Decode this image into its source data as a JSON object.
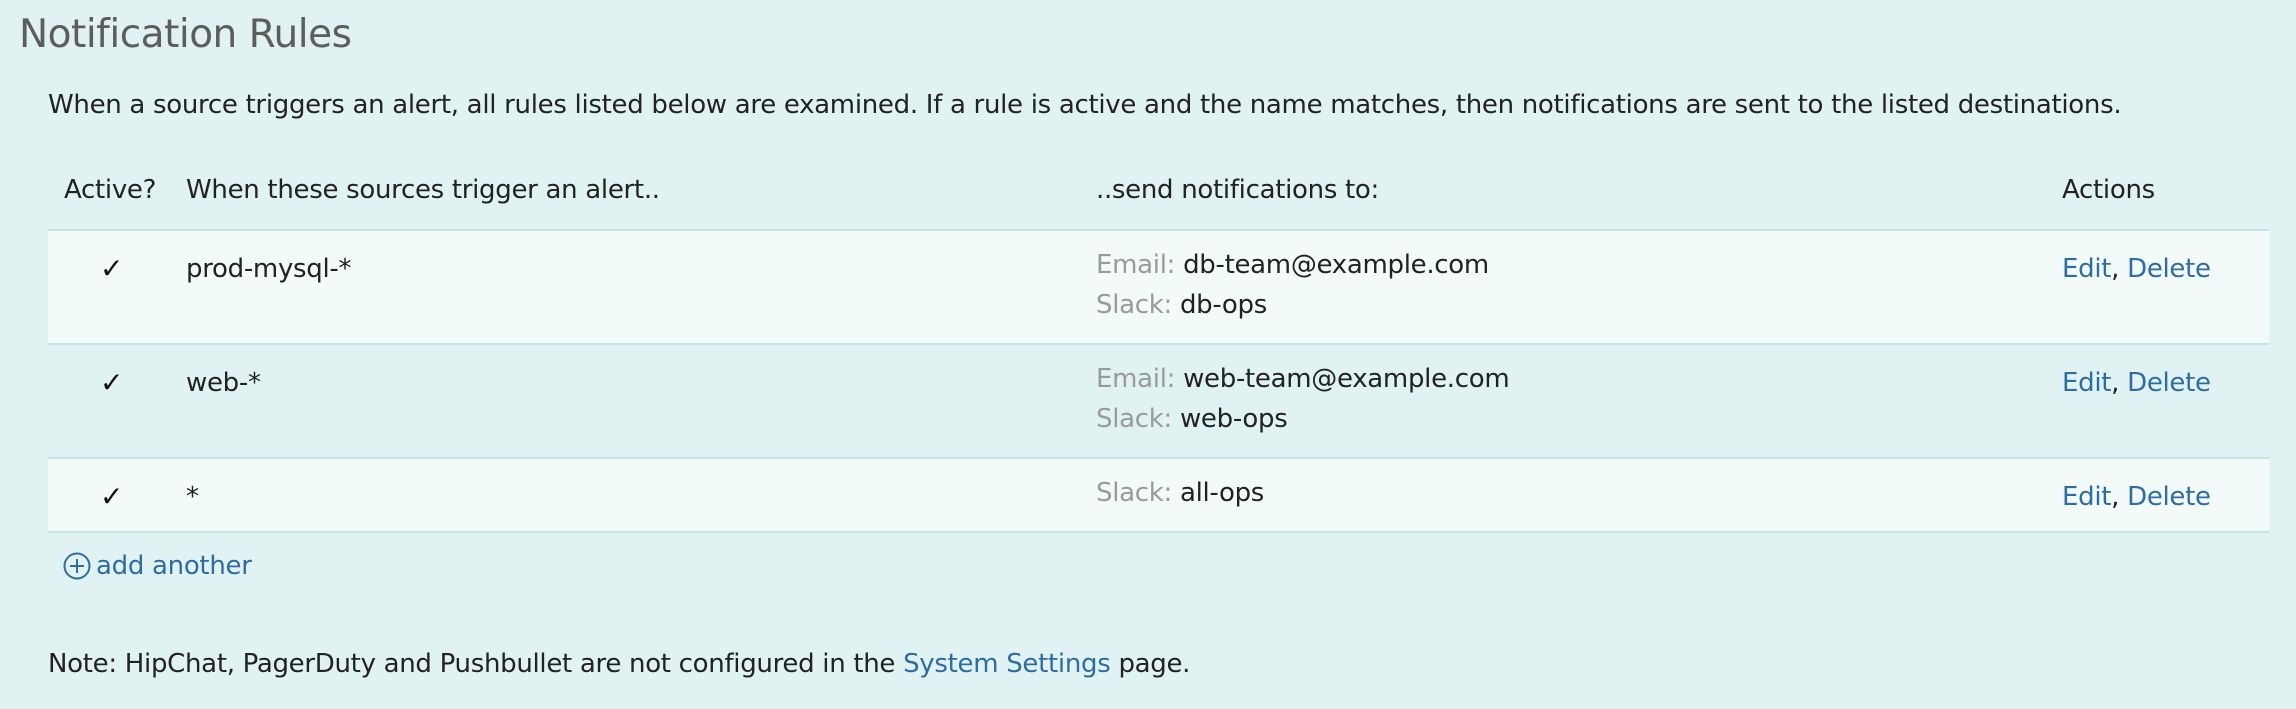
{
  "page": {
    "title": "Notification Rules",
    "intro": "When a source triggers an alert, all rules listed below are examined. If a rule is active and the name matches, then notifications are sent to the listed destinations."
  },
  "table": {
    "headers": {
      "active": "Active?",
      "sources": "When these sources trigger an alert..",
      "destinations": "..send notifications to:",
      "actions": "Actions"
    },
    "rows": [
      {
        "active": "✓",
        "source": "prod-mysql-*",
        "destinations": [
          {
            "label": "Email:",
            "value": "db-team@example.com"
          },
          {
            "label": "Slack:",
            "value": "db-ops"
          }
        ],
        "edit": "Edit",
        "sep": ",",
        "delete": "Delete"
      },
      {
        "active": "✓",
        "source": "web-*",
        "destinations": [
          {
            "label": "Email:",
            "value": "web-team@example.com"
          },
          {
            "label": "Slack:",
            "value": "web-ops"
          }
        ],
        "edit": "Edit",
        "sep": ",",
        "delete": "Delete"
      },
      {
        "active": "✓",
        "source": "*",
        "destinations": [
          {
            "label": "Slack:",
            "value": "all-ops"
          }
        ],
        "edit": "Edit",
        "sep": ",",
        "delete": "Delete"
      }
    ]
  },
  "add_another": {
    "icon": "plus-circle-icon",
    "label": "add another"
  },
  "note": {
    "prefix": "Note: HipChat, PagerDuty and Pushbullet are not configured in the",
    "link": "System Settings",
    "suffix": "page."
  },
  "colors": {
    "background": "#e1f2f2",
    "row_alt": "#f2fafa",
    "link": "#2e6da4",
    "muted_label": "#9a9a9a",
    "title": "#5d5d5d"
  }
}
